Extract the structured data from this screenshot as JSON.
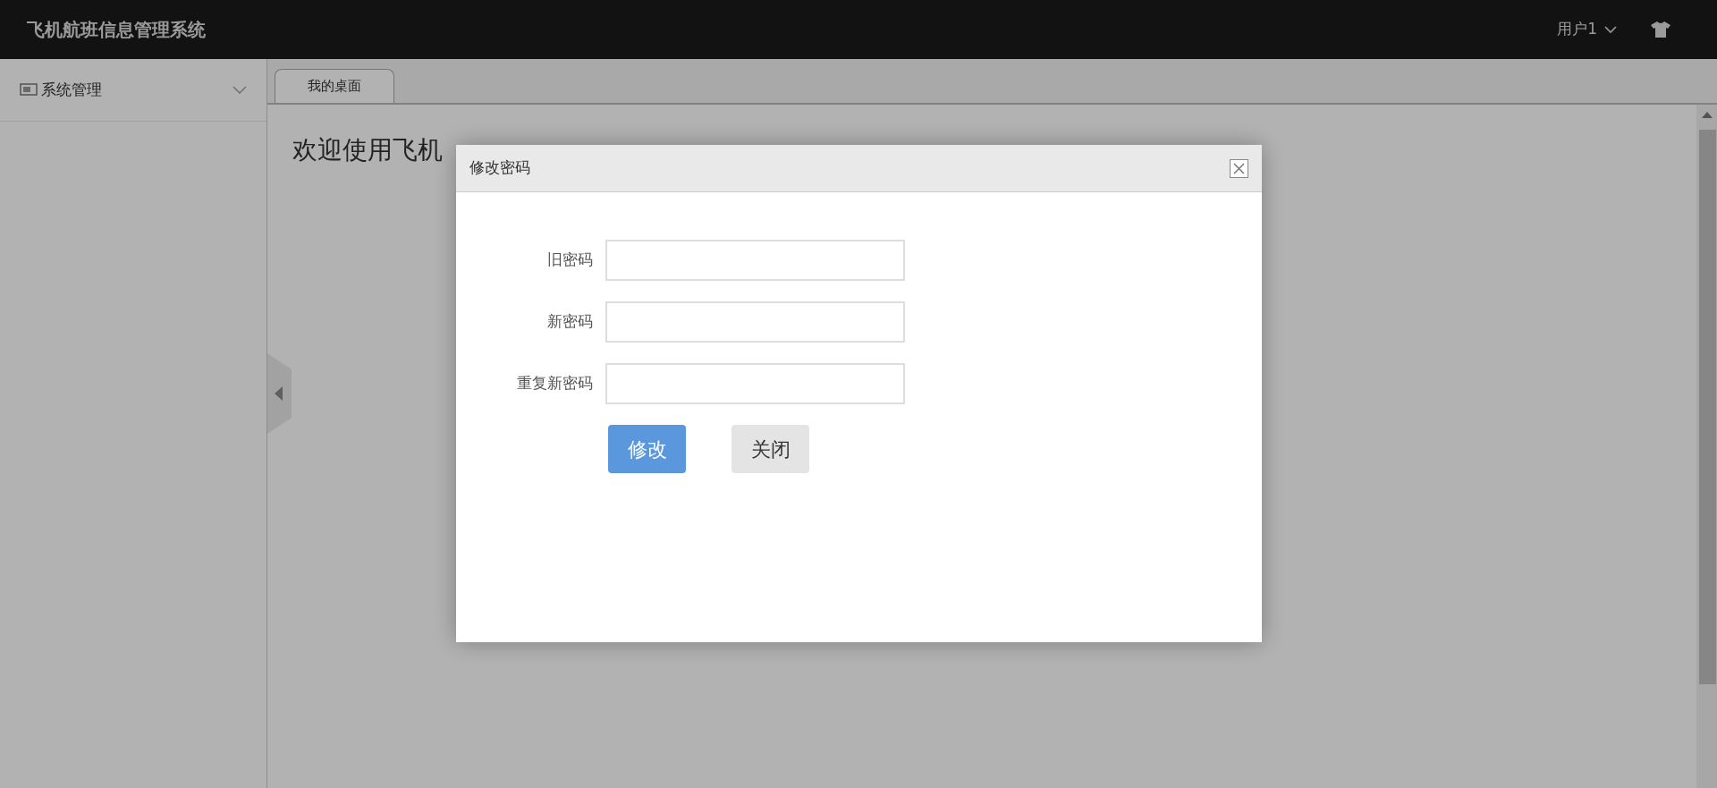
{
  "header": {
    "title": "飞机航班信息管理系统",
    "user_menu": "用户1"
  },
  "sidebar": {
    "items": [
      {
        "label": "系统管理",
        "expanded": false
      }
    ]
  },
  "tabs": [
    {
      "label": "我的桌面",
      "selected": true
    }
  ],
  "content": {
    "welcome": "欢迎使用飞机"
  },
  "dialog": {
    "title": "修改密码",
    "fields": [
      {
        "label": "旧密码"
      },
      {
        "label": "新密码"
      },
      {
        "label": "重复新密码"
      }
    ],
    "buttons": [
      {
        "label": "修改",
        "kind": "primary"
      },
      {
        "label": "关闭",
        "kind": "secondary"
      }
    ]
  }
}
